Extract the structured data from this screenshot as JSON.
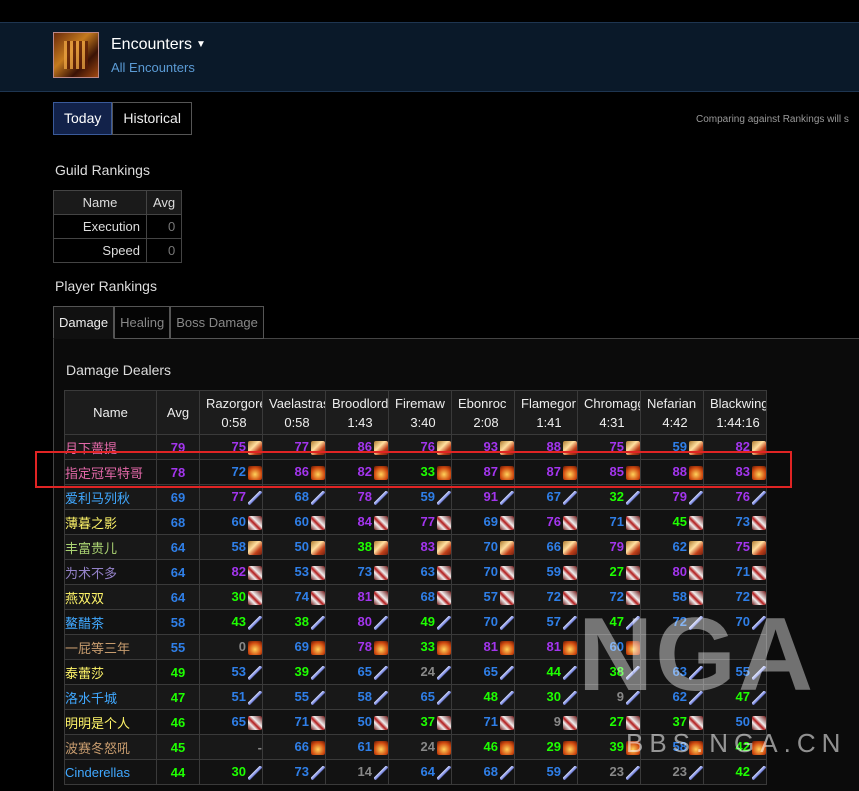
{
  "header": {
    "title": "Encounters",
    "subtitle": "All Encounters"
  },
  "top_tabs": [
    {
      "label": "Today",
      "active": true
    },
    {
      "label": "Historical",
      "active": false
    }
  ],
  "compare_text": "Comparing against Rankings will s",
  "guild_rankings": {
    "title": "Guild Rankings",
    "headers": [
      "Name",
      "Avg"
    ],
    "rows": [
      {
        "label": "Execution",
        "value": "0"
      },
      {
        "label": "Speed",
        "value": "0"
      }
    ]
  },
  "player_rankings": {
    "title": "Player Rankings",
    "tabs": [
      {
        "label": "Damage",
        "active": true
      },
      {
        "label": "Healing",
        "active": false
      },
      {
        "label": "Boss Damage",
        "active": false
      }
    ],
    "table_title": "Damage Dealers",
    "columns": [
      {
        "name": "Name",
        "time": ""
      },
      {
        "name": "Avg",
        "time": ""
      },
      {
        "name": "Razorgore",
        "time": "0:58"
      },
      {
        "name": "Vaelastrasz",
        "time": "0:58"
      },
      {
        "name": "Broodlord",
        "time": "1:43"
      },
      {
        "name": "Firemaw",
        "time": "3:40"
      },
      {
        "name": "Ebonroc",
        "time": "2:08"
      },
      {
        "name": "Flamegor",
        "time": "1:41"
      },
      {
        "name": "Chromaggus",
        "time": "4:31"
      },
      {
        "name": "Nefarian",
        "time": "4:42"
      },
      {
        "name": "Blackwing",
        "time": "1:44:16"
      }
    ],
    "players": [
      {
        "name": "月下蔷提",
        "color": "#e268a8",
        "icon": "rune-icon",
        "avg": "79",
        "values": [
          "75",
          "77",
          "86",
          "76",
          "93",
          "88",
          "75",
          "59",
          "82"
        ]
      },
      {
        "name": "指定冠军特哥",
        "color": "#e268a8",
        "icon": "fire-icon",
        "avg": "78",
        "values": [
          "72",
          "86",
          "82",
          "33",
          "87",
          "87",
          "85",
          "88",
          "83"
        ]
      },
      {
        "name": "爱利马列秋",
        "color": "#40a8ff",
        "icon": "spear-icon",
        "avg": "69",
        "values": [
          "77",
          "68",
          "78",
          "59",
          "91",
          "67",
          "32",
          "79",
          "76"
        ]
      },
      {
        "name": "薄暮之影",
        "color": "#fff569",
        "icon": "slash-icon",
        "avg": "68",
        "values": [
          "60",
          "60",
          "84",
          "77",
          "69",
          "76",
          "71",
          "45",
          "73"
        ]
      },
      {
        "name": "丰富贵儿",
        "color": "#abd473",
        "icon": "rune-icon",
        "avg": "64",
        "values": [
          "58",
          "50",
          "38",
          "83",
          "70",
          "66",
          "79",
          "62",
          "75"
        ]
      },
      {
        "name": "为术不多",
        "color": "#9482c9",
        "icon": "slash-icon",
        "avg": "64",
        "values": [
          "82",
          "53",
          "73",
          "63",
          "70",
          "59",
          "27",
          "80",
          "71"
        ]
      },
      {
        "name": "燕双双",
        "color": "#fff569",
        "icon": "slash-icon",
        "avg": "64",
        "values": [
          "30",
          "74",
          "81",
          "68",
          "57",
          "72",
          "72",
          "58",
          "72"
        ]
      },
      {
        "name": "鳌醋茶",
        "color": "#40a8ff",
        "icon": "spear-icon",
        "avg": "58",
        "values": [
          "43",
          "38",
          "80",
          "49",
          "70",
          "57",
          "47",
          "72",
          "70"
        ]
      },
      {
        "name": "一屁等三年",
        "color": "#c79c6e",
        "icon": "fire-icon",
        "avg": "55",
        "values": [
          "0",
          "69",
          "78",
          "33",
          "81",
          "81",
          "60",
          "",
          ""
        ]
      },
      {
        "name": "泰蕾莎",
        "color": "#fff569",
        "icon": "spear-icon",
        "avg": "49",
        "values": [
          "53",
          "39",
          "65",
          "24",
          "65",
          "44",
          "38",
          "63",
          "55"
        ]
      },
      {
        "name": "洛水千城",
        "color": "#40a8ff",
        "icon": "spear-icon",
        "avg": "47",
        "values": [
          "51",
          "55",
          "58",
          "65",
          "48",
          "30",
          "9",
          "62",
          "47"
        ]
      },
      {
        "name": "明明是个人",
        "color": "#fff569",
        "icon": "slash-icon",
        "avg": "46",
        "values": [
          "65",
          "71",
          "50",
          "37",
          "71",
          "9",
          "27",
          "37",
          "50"
        ]
      },
      {
        "name": "波赛冬怒吼",
        "color": "#c79c6e",
        "icon": "fire-icon",
        "avg": "45",
        "values": [
          "-",
          "66",
          "61",
          "24",
          "46",
          "29",
          "39",
          "58",
          "42"
        ]
      },
      {
        "name": "Cinderellas",
        "color": "#40a8ff",
        "icon": "spear-icon",
        "avg": "44",
        "values": [
          "30",
          "73",
          "14",
          "64",
          "68",
          "59",
          "23",
          "23",
          "42"
        ]
      }
    ]
  },
  "watermark": {
    "big": "NGA",
    "small": "BBS.NGA.CN"
  }
}
